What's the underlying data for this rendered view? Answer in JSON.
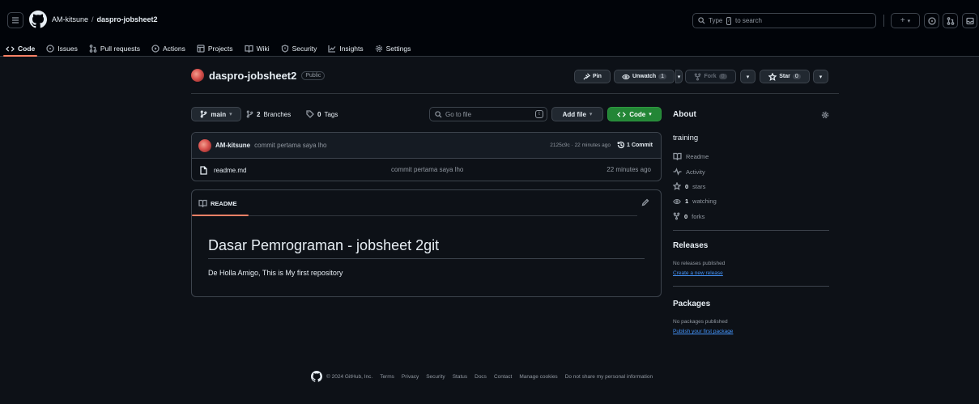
{
  "header": {
    "owner": "AM-kitsune",
    "separator": "/",
    "repo": "daspro-jobsheet2",
    "search_prefix": "Type",
    "search_key": "/",
    "search_suffix": "to search",
    "plus_label": "+",
    "caret_label": "▾"
  },
  "tabs": [
    {
      "label": "Code",
      "icon": "code-icon"
    },
    {
      "label": "Issues",
      "icon": "issue-icon"
    },
    {
      "label": "Pull requests",
      "icon": "pull-request-icon"
    },
    {
      "label": "Actions",
      "icon": "play-icon"
    },
    {
      "label": "Projects",
      "icon": "table-icon"
    },
    {
      "label": "Wiki",
      "icon": "book-icon"
    },
    {
      "label": "Security",
      "icon": "shield-icon"
    },
    {
      "label": "Insights",
      "icon": "graph-icon"
    },
    {
      "label": "Settings",
      "icon": "gear-icon"
    }
  ],
  "repo_header": {
    "name": "daspro-jobsheet2",
    "visibility": "Public",
    "pin_label": "Pin",
    "unwatch_label": "Unwatch",
    "watch_count": "1",
    "fork_label": "Fork",
    "fork_count": "0",
    "star_label": "Star",
    "star_count": "0"
  },
  "toolbar": {
    "branch": "main",
    "branches_count": "2",
    "branches_label": "Branches",
    "tags_count": "0",
    "tags_label": "Tags",
    "goto_placeholder": "Go to file",
    "goto_key": "t",
    "add_file_label": "Add file",
    "code_label": "Code"
  },
  "latest_commit": {
    "author": "AM-kitsune",
    "message": "commit pertama saya lho",
    "hash_time": "2125c9c · 22 minutes ago",
    "commits_count": "1",
    "commits_label": "Commit"
  },
  "files": [
    {
      "name": "readme.md",
      "commit": "commit pertama saya lho",
      "time": "22 minutes ago"
    }
  ],
  "readme": {
    "tab_label": "README",
    "heading": "Dasar Pemrograman - jobsheet 2git",
    "paragraph": "De Holla Amigo, This is My first repository"
  },
  "about": {
    "title": "About",
    "description": "training",
    "readme_label": "Readme",
    "activity_label": "Activity",
    "stars_count": "0",
    "stars_label": "stars",
    "watching_count": "1",
    "watching_label": "watching",
    "forks_count": "0",
    "forks_label": "forks"
  },
  "releases": {
    "title": "Releases",
    "none_text": "No releases published",
    "create_link": "Create a new release"
  },
  "packages": {
    "title": "Packages",
    "none_text": "No packages published",
    "publish_link": "Publish your first package"
  },
  "footer": {
    "copyright": "© 2024 GitHub, Inc.",
    "links": [
      "Terms",
      "Privacy",
      "Security",
      "Status",
      "Docs",
      "Contact",
      "Manage cookies",
      "Do not share my personal information"
    ]
  },
  "colors": {
    "background": "#0d1117",
    "header_bg": "#010409",
    "border": "#3d444d",
    "muted": "#9198a1",
    "accent_tab": "#f78166",
    "green_button": "#238636",
    "link": "#4493f8"
  }
}
